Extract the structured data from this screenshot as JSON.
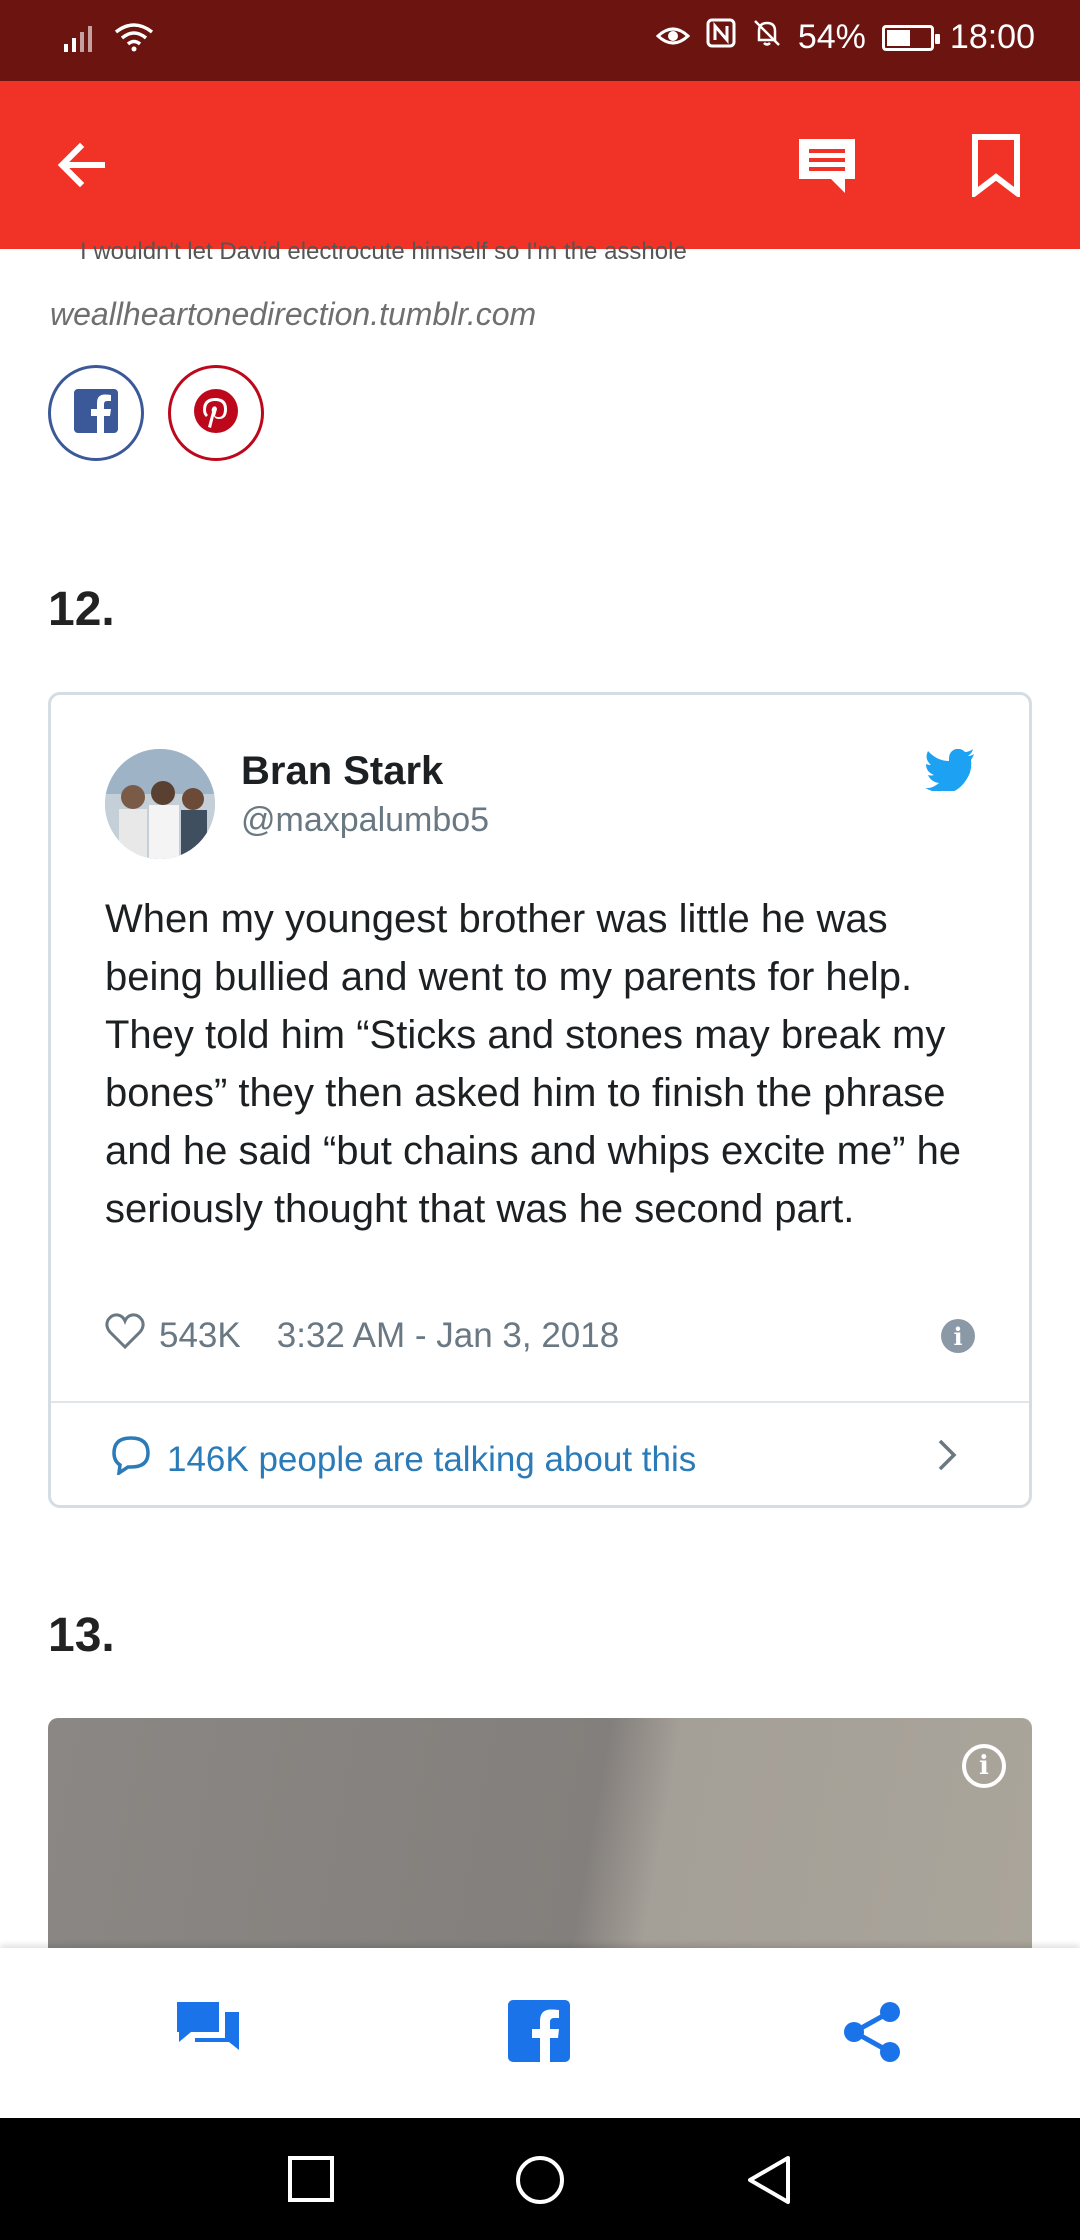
{
  "status_bar": {
    "battery": "54%",
    "battery_level": 0.54,
    "time": "18:00",
    "icons": [
      "signal-icon",
      "wifi-icon",
      "eye-icon",
      "nfc-icon",
      "mute-icon",
      "battery-icon"
    ]
  },
  "app_bar": {
    "color": "#f03326",
    "icons": [
      "back-arrow-icon",
      "comments-icon",
      "bookmark-icon"
    ]
  },
  "content": {
    "clipped_caption": "I wouldn't let David electrocute himself so I'm the asshole",
    "source": "weallheartonedirection.tumblr.com",
    "share_icons": [
      "facebook-icon",
      "pinterest-icon"
    ],
    "item_12": "12.",
    "item_13": "13."
  },
  "tweet": {
    "name": "Bran Stark",
    "handle": "@maxpalumbo5",
    "text": "When my youngest brother was little he was being bullied and went to my parents for help. They told him “Sticks and stones may break my bones” they then asked him to finish the phrase and he said “but chains and whips excite me” he seriously thought that was he second part.",
    "likes": "543K",
    "timestamp": "3:32 AM - Jan 3, 2018",
    "talking": "146K people are talking about this"
  },
  "bottom_bar": {
    "accent": "#1a73e8",
    "icons": [
      "comments-icon",
      "facebook-icon",
      "share-icon"
    ]
  },
  "nav_bar": {
    "icons": [
      "recent-apps-icon",
      "home-icon",
      "back-icon"
    ]
  }
}
